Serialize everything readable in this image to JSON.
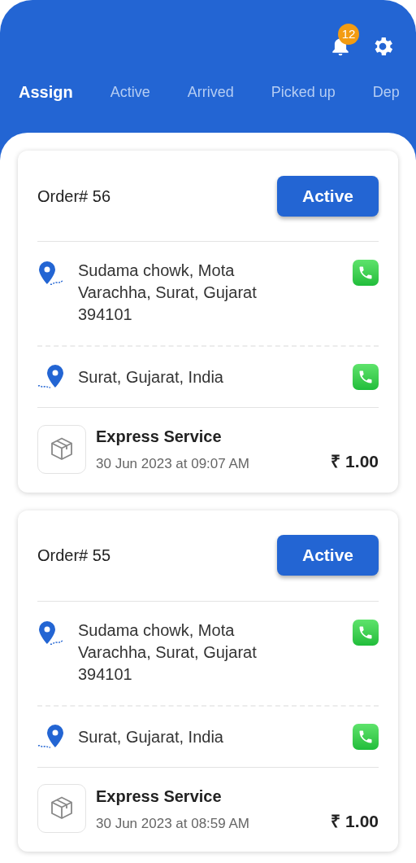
{
  "header": {
    "notification_count": "12"
  },
  "tabs": [
    {
      "label": "Assign",
      "selected": true
    },
    {
      "label": "Active",
      "selected": false
    },
    {
      "label": "Arrived",
      "selected": false
    },
    {
      "label": "Picked up",
      "selected": false
    },
    {
      "label": "Dep",
      "selected": false
    }
  ],
  "orders": [
    {
      "title": "Order# 56",
      "status_button": "Active",
      "pickup": "Sudama chowk, Mota Varachha, Surat, Gujarat 394101",
      "drop": "Surat, Gujarat, India",
      "service": "Express Service",
      "datetime": "30 Jun 2023 at 09:07 AM",
      "price": "₹ 1.00"
    },
    {
      "title": "Order# 55",
      "status_button": "Active",
      "pickup": "Sudama chowk, Mota Varachha, Surat, Gujarat 394101",
      "drop": "Surat, Gujarat, India",
      "service": "Express Service",
      "datetime": "30 Jun 2023 at 08:59 AM",
      "price": "₹ 1.00"
    }
  ]
}
